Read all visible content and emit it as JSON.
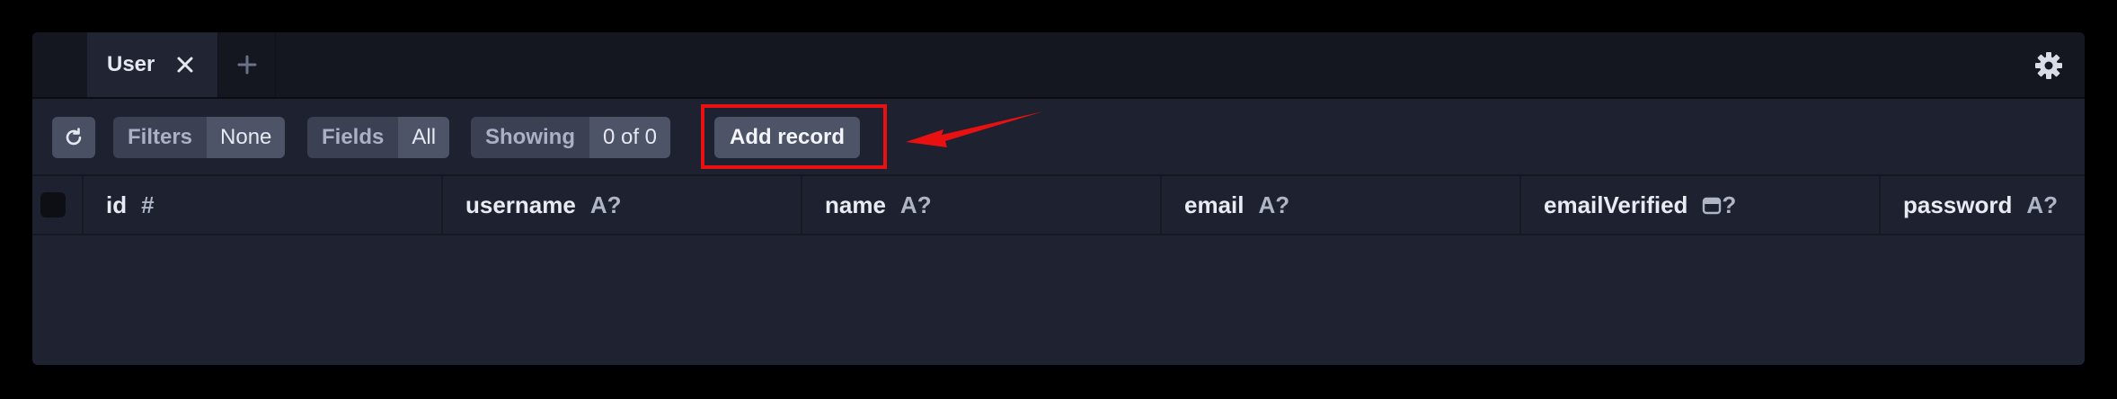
{
  "tabs": [
    {
      "label": "User",
      "close_glyph": "✕"
    }
  ],
  "add_tab_glyph": "+",
  "icons": {
    "settings": "gear-icon",
    "refresh": "refresh-icon",
    "calendar": "calendar-icon"
  },
  "toolbar": {
    "filters": {
      "label": "Filters",
      "value": "None"
    },
    "fields": {
      "label": "Fields",
      "value": "All"
    },
    "showing": {
      "label": "Showing",
      "value": "0 of 0"
    },
    "add_record_label": "Add record"
  },
  "columns": [
    {
      "name": "id",
      "type": "#"
    },
    {
      "name": "username",
      "type": "A?"
    },
    {
      "name": "name",
      "type": "A?"
    },
    {
      "name": "email",
      "type": "A?"
    },
    {
      "name": "emailVerified",
      "type": "?"
    },
    {
      "name": "password",
      "type": "A?"
    }
  ],
  "colors": {
    "annotation": "#e81010",
    "background": "#1f2230"
  }
}
